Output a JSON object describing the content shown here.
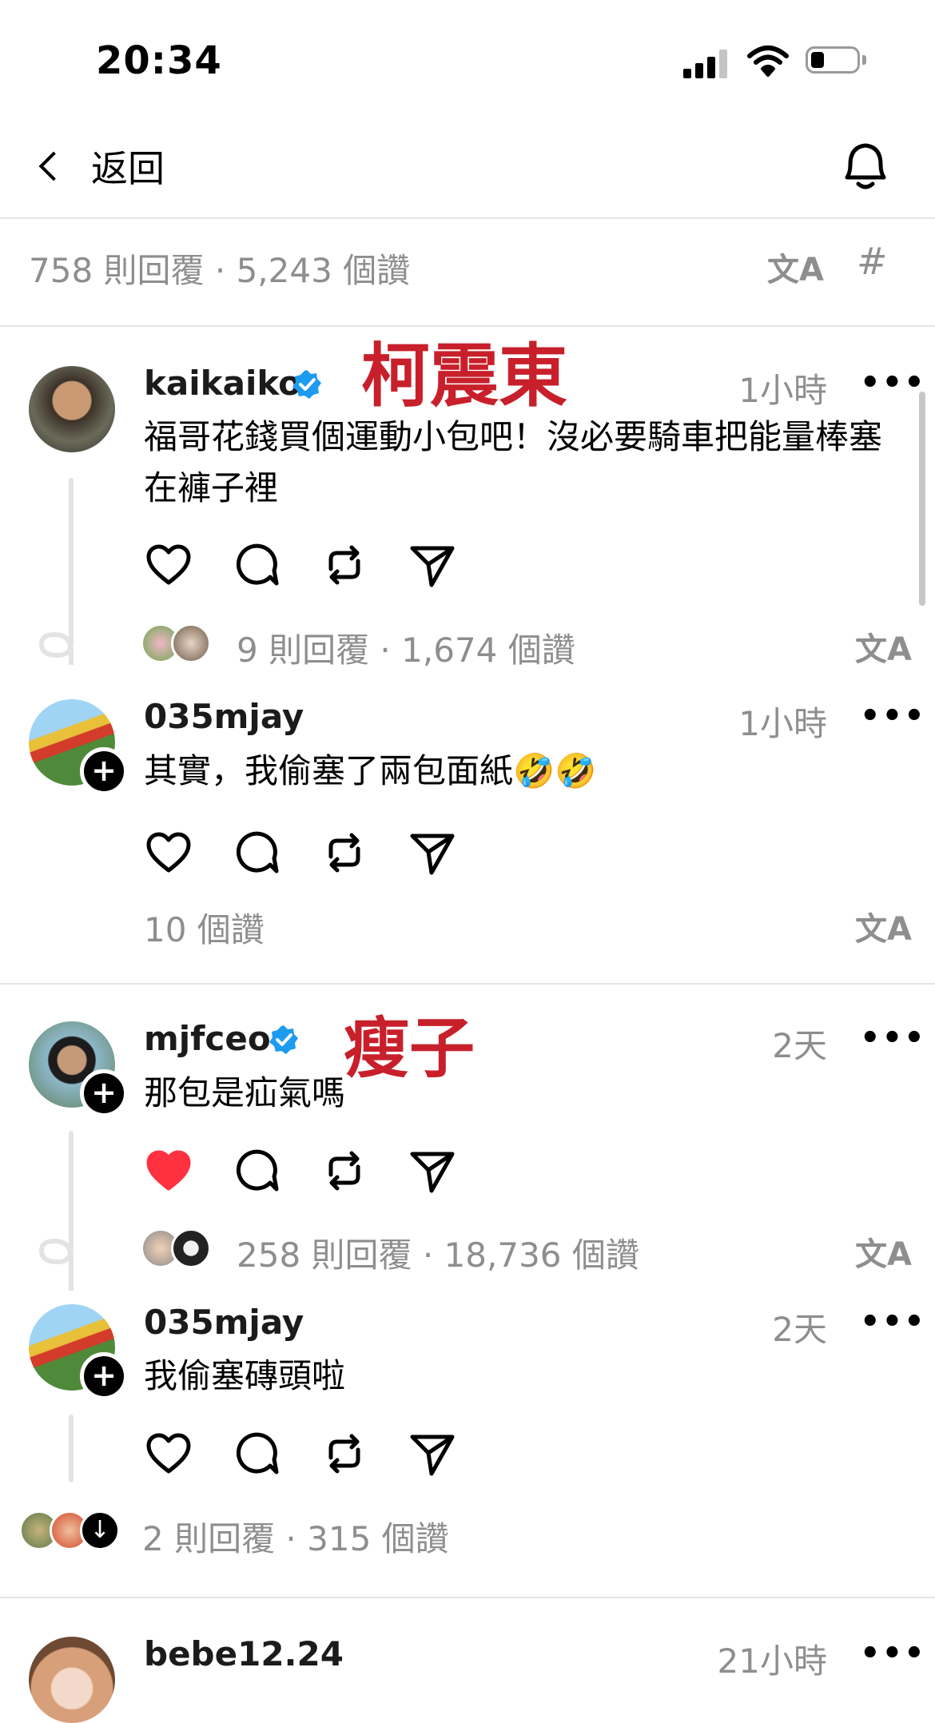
{
  "status_bar": {
    "time": "20:34"
  },
  "header": {
    "back_label": "返回"
  },
  "post_summary": {
    "text": "758 則回覆 · 5,243 個讚",
    "translate_icon": "translate-icon",
    "hashtag_icon": "#"
  },
  "threads": [
    {
      "comment": {
        "username": "kaikaiko",
        "verified": true,
        "annotation": "柯震東",
        "time": "1小時",
        "text": "福哥花錢買個運動小包吧！沒必要騎車把能量棒塞在褲子裡",
        "liked": false,
        "replies_summary": "9 則回覆 · 1,674 個讚"
      },
      "reply": {
        "username": "035mjay",
        "time": "1小時",
        "text": "其實，我偷塞了兩包面紙🤣🤣",
        "likes": "10 個讚"
      }
    },
    {
      "comment": {
        "username": "mjfceo",
        "verified": true,
        "annotation": "瘦子",
        "time": "2天",
        "text": "那包是疝氣嗎",
        "liked": true,
        "replies_summary": "258 則回覆 · 18,736 個讚"
      },
      "reply": {
        "username": "035mjay",
        "time": "2天",
        "text": "我偷塞磚頭啦",
        "replies_summary": "2 則回覆 · 315 個讚"
      }
    }
  ],
  "next_comment": {
    "username": "bebe12.24",
    "time": "21小時"
  },
  "more_label": "•••",
  "colors": {
    "liked_heart": "#ff3040",
    "verified": "#1d9bf0",
    "annotation": "#c8202b",
    "muted": "#8e8e8e"
  }
}
